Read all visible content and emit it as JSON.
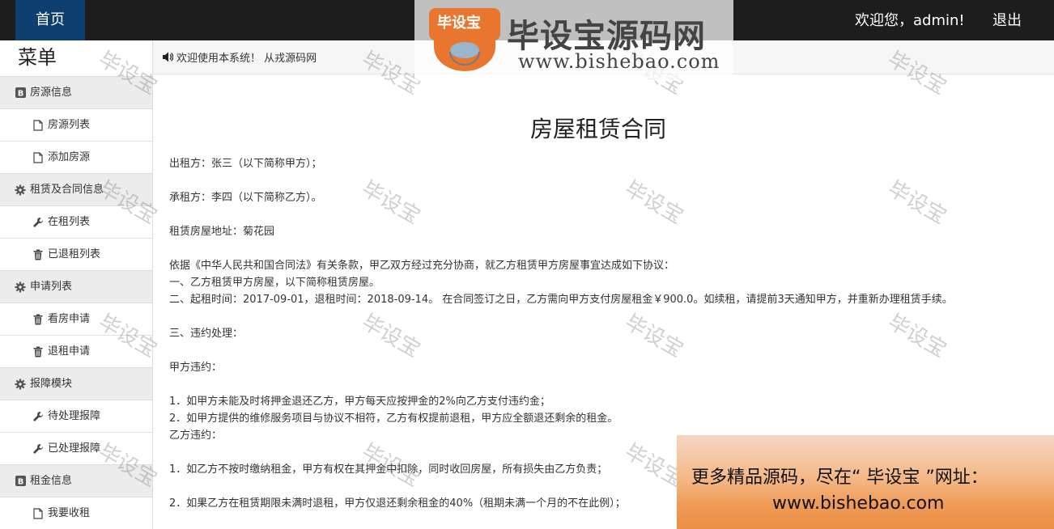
{
  "header": {
    "home_label": "首页",
    "welcome": "欢迎您，admin!",
    "logout_label": "退出"
  },
  "sidebar": {
    "title": "菜单",
    "groups": [
      {
        "label": "房源信息",
        "icon": "bold-b-icon",
        "items": [
          {
            "label": "房源列表",
            "icon": "file-icon"
          },
          {
            "label": "添加房源",
            "icon": "file-icon"
          }
        ]
      },
      {
        "label": "租赁及合同信息",
        "icon": "gear-icon",
        "items": [
          {
            "label": "在租列表",
            "icon": "wrench-icon"
          },
          {
            "label": "已退租列表",
            "icon": "trash-icon"
          }
        ]
      },
      {
        "label": "申请列表",
        "icon": "gear-icon",
        "items": [
          {
            "label": "看房申请",
            "icon": "trash-icon"
          },
          {
            "label": "退租申请",
            "icon": "trash-icon"
          }
        ]
      },
      {
        "label": "报障模块",
        "icon": "gear-icon",
        "items": [
          {
            "label": "待处理报障",
            "icon": "wrench-icon"
          },
          {
            "label": "已处理报障",
            "icon": "wrench-icon"
          }
        ]
      },
      {
        "label": "租金信息",
        "icon": "bold-b-icon",
        "items": [
          {
            "label": "我要收租",
            "icon": "file-icon"
          }
        ]
      }
    ]
  },
  "notice": {
    "icon": "speaker-icon",
    "text": "欢迎使用本系统！ 从戎源码网"
  },
  "contract": {
    "title": "房屋租赁合同",
    "lessor": "出租方：张三（以下简称甲方）；",
    "lessee": "承租方：李四（以下简称乙方）。",
    "address": "租赁房屋地址：菊花园",
    "intro": "依据《中华人民共和国合同法》有关条款，甲乙双方经过充分协商，就乙方租赁甲方房屋事宜达成如下协议：",
    "clause1": "一、乙方租赁甲方房屋，以下简称租赁房屋。",
    "clause2": "二、起租时间：2017-09-01，退租时间：2018-09-14。 在合同签订之日，乙方需向甲方支付房屋租金￥900.0。如续租，请提前3天通知甲方，并重新办理租赁手续。",
    "clause3": "三、违约处理：",
    "party_a_breach": "甲方违约：",
    "a1": "1．如甲方未能及时将押金退还乙方，甲方每天应按押金的2%向乙方支付违约金；",
    "a2": "2．如甲方提供的维修服务项目与协议不相符，乙方有权提前退租，甲方应全额退还剩余的租金。",
    "party_b_breach": "乙方违约：",
    "b1": "1．如乙方不按时缴纳租金，甲方有权在其押金中扣除，同时收回房屋，所有损失由乙方负责；",
    "b2": "2．如果乙方在租赁期限未满时退租，甲方仅退还剩余租金的40%（租期未满一个月的不在此例）；"
  },
  "watermark": {
    "brand_cn": "毕设宝源码网",
    "brand_url": "www.bishebao.com",
    "logo_text": "毕设宝",
    "diagonal_text": "毕设宝"
  },
  "ad": {
    "line1": "更多精品源码，尽在“ 毕设宝 ”网址：",
    "line2": "www.bishebao.com"
  },
  "colors": {
    "topbar": "#1d1d1d",
    "home_tab": "#0f3e71",
    "sidebar_group_bg": "#ececec",
    "logo_orange": "#e8762e"
  }
}
